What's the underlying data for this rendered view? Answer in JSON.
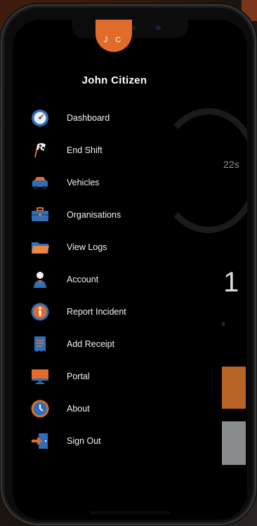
{
  "user": {
    "initials": "J C",
    "name": "John Citizen"
  },
  "menu": {
    "items": [
      {
        "label": "Dashboard",
        "icon": "speedometer-icon"
      },
      {
        "label": "End Shift",
        "icon": "checkered-flag-icon"
      },
      {
        "label": "Vehicles",
        "icon": "car-icon"
      },
      {
        "label": "Organisations",
        "icon": "briefcase-icon"
      },
      {
        "label": "View Logs",
        "icon": "folder-icon"
      },
      {
        "label": "Account",
        "icon": "person-icon"
      },
      {
        "label": "Report Incident",
        "icon": "info-icon"
      },
      {
        "label": "Add Receipt",
        "icon": "receipt-icon"
      },
      {
        "label": "Portal",
        "icon": "monitor-icon"
      },
      {
        "label": "About",
        "icon": "clock-icon"
      },
      {
        "label": "Sign Out",
        "icon": "sign-out-icon"
      }
    ]
  },
  "background_panel": {
    "timer": "22s",
    "big_number": "1",
    "small_label": "c"
  },
  "colors": {
    "accent": "#E06B2A",
    "menu_background": "#000000",
    "text": "#F2F2F2",
    "icon_blue": "#2E6FB8"
  }
}
